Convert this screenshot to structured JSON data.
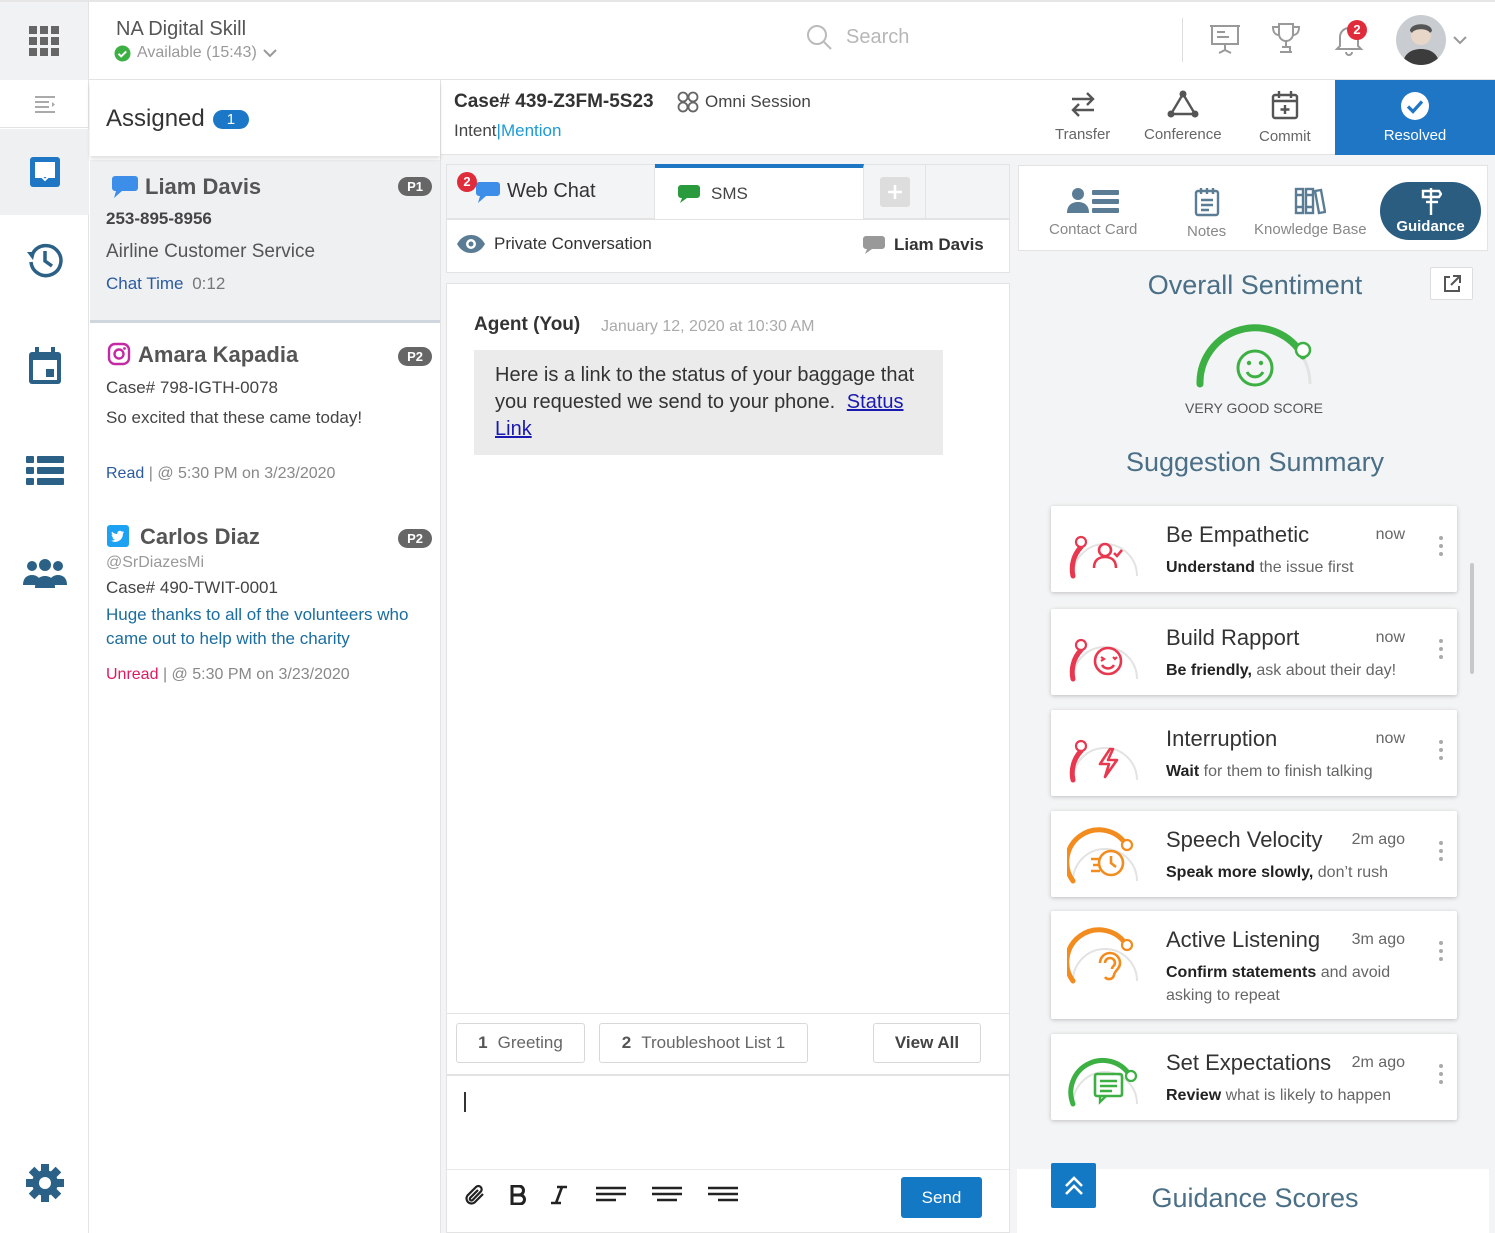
{
  "topbar": {
    "skill_name": "NA Digital Skill",
    "status": "Available (15:43)",
    "search_placeholder": "Search",
    "notification_count": "2"
  },
  "assigned": {
    "title": "Assigned",
    "count": "1",
    "items": [
      {
        "name": "Liam Davis",
        "priority": "P1",
        "phone": "253-895-8956",
        "queue": "Airline Customer Service",
        "chat_time_label": "Chat Time",
        "chat_time": "0:12"
      },
      {
        "name": "Amara Kapadia",
        "priority": "P2",
        "case": "Case# 798-IGTH-0078",
        "message": "So excited that these came today!",
        "status": "Read",
        "time": "@ 5:30 PM on 3/23/2020"
      },
      {
        "name": "Carlos Diaz",
        "priority": "P2",
        "handle": "@SrDiazesMi",
        "case": "Case# 490-TWIT-0001",
        "message": "Huge thanks to all of the volunteers who came out to help with the charity",
        "status": "Unread",
        "time": "@ 5:30 PM on 3/23/2020"
      }
    ],
    "separator": "|"
  },
  "case": {
    "number": "Case# 439-Z3FM-5S23",
    "session": "Omni Session",
    "intent": "Intent",
    "mention": "Mention",
    "actions": {
      "transfer": "Transfer",
      "conference": "Conference",
      "commit": "Commit",
      "resolved": "Resolved"
    }
  },
  "chat": {
    "tabs": {
      "webchat": "Web Chat",
      "webchat_badge": "2",
      "sms": "SMS"
    },
    "private_label": "Private Conversation",
    "participant": "Liam Davis",
    "message": {
      "author": "Agent (You)",
      "timestamp": "January 12, 2020 at 10:30 AM",
      "text": "Here is a link to the status of your baggage that you requested we send to your phone.",
      "link": "Status Link"
    },
    "quick": [
      {
        "num": "1",
        "label": "Greeting"
      },
      {
        "num": "2",
        "label": "Troubleshoot List 1"
      }
    ],
    "view_all": "View All",
    "send": "Send"
  },
  "right": {
    "tabs": {
      "contact_card": "Contact Card",
      "notes": "Notes",
      "knowledge_base": "Knowledge Base",
      "guidance": "Guidance"
    },
    "overall_sentiment": "Overall Sentiment",
    "sentiment_score_label": "VERY GOOD SCORE",
    "suggestion_summary": "Suggestion Summary",
    "guidance_scores": "Guidance Scores",
    "suggestions": [
      {
        "title": "Be Empathetic",
        "bold": "Understand",
        "rest": " the issue first",
        "time": "now",
        "color": "#e8384f",
        "icon": "person-check-icon"
      },
      {
        "title": "Build Rapport",
        "bold": "Be friendly,",
        "rest": " ask about their day!",
        "time": "now",
        "color": "#e8384f",
        "icon": "smile-wink-icon"
      },
      {
        "title": "Interruption",
        "bold": "Wait",
        "rest": " for them to finish talking",
        "time": "now",
        "color": "#e8384f",
        "icon": "bolt-icon"
      },
      {
        "title": "Speech Velocity",
        "bold": "Speak more slowly,",
        "rest": " don’t rush",
        "time": "2m ago",
        "color": "#f28c1e",
        "icon": "fast-clock-icon"
      },
      {
        "title": "Active Listening",
        "bold": "Confirm statements",
        "rest": " and avoid asking to repeat",
        "time": "3m ago",
        "color": "#f28c1e",
        "icon": "ear-icon"
      },
      {
        "title": "Set Expectations",
        "bold": "Review",
        "rest": " what is likely to happen",
        "time": "2m ago",
        "color": "#3cb043",
        "icon": "message-lines-icon"
      }
    ]
  },
  "colors": {
    "accent": "#1e76c4",
    "good": "#3cb043",
    "danger": "#e8384f",
    "warning": "#f28c1e"
  }
}
